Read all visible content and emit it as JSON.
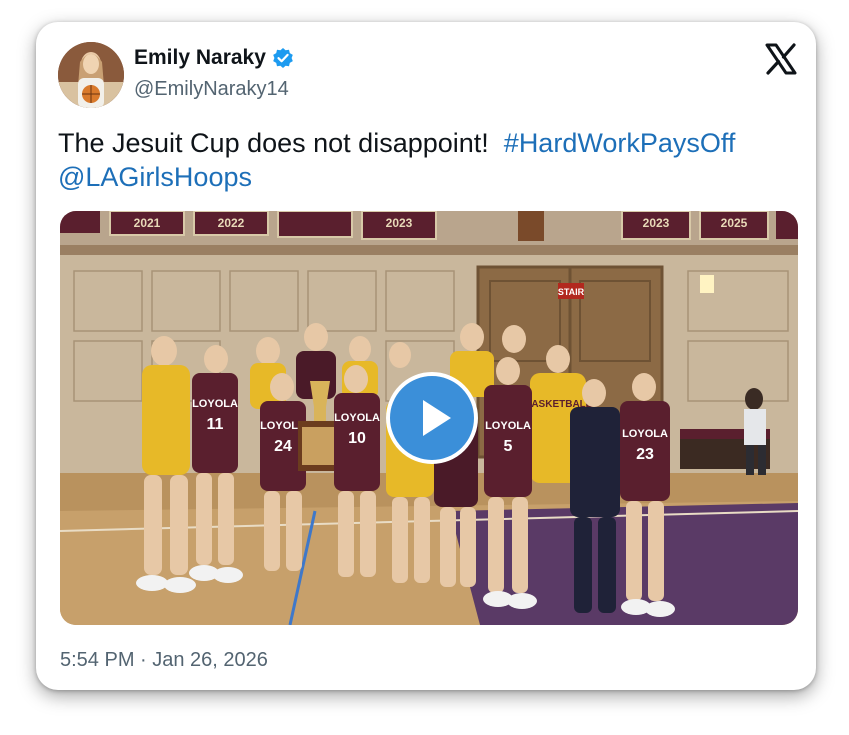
{
  "tweet": {
    "display_name": "Emily Naraky",
    "handle": "@EmilyNaraky14",
    "text_main": "The Jesuit Cup does not disappoint!",
    "hashtag": "#HardWorkPaysOff",
    "mention": "@LAGirlsHoops",
    "timestamp": "5:54 PM · Jan 26, 2026",
    "verified": true
  },
  "media": {
    "type": "video",
    "banners": [
      "2021",
      "2022",
      "2023",
      "2023",
      "2025"
    ],
    "sign": "STAIR",
    "jerseys": [
      {
        "team": "LOYOLA",
        "number": "11"
      },
      {
        "team": "LOYOLA",
        "number": "24"
      },
      {
        "team": "LOYOLA",
        "number": "10"
      },
      {
        "team": "LOYOLA",
        "number": "5"
      },
      {
        "team": "LOYOLA",
        "number": "23"
      }
    ]
  },
  "icons": {
    "verified": "verified-badge-icon",
    "logo": "x-logo-icon",
    "play": "play-icon"
  },
  "colors": {
    "link": "#1d6fb8",
    "verified": "#1d9bf0",
    "play": "#3b8fd9",
    "maroon": "#5a1f2e",
    "gold": "#e7b928"
  }
}
